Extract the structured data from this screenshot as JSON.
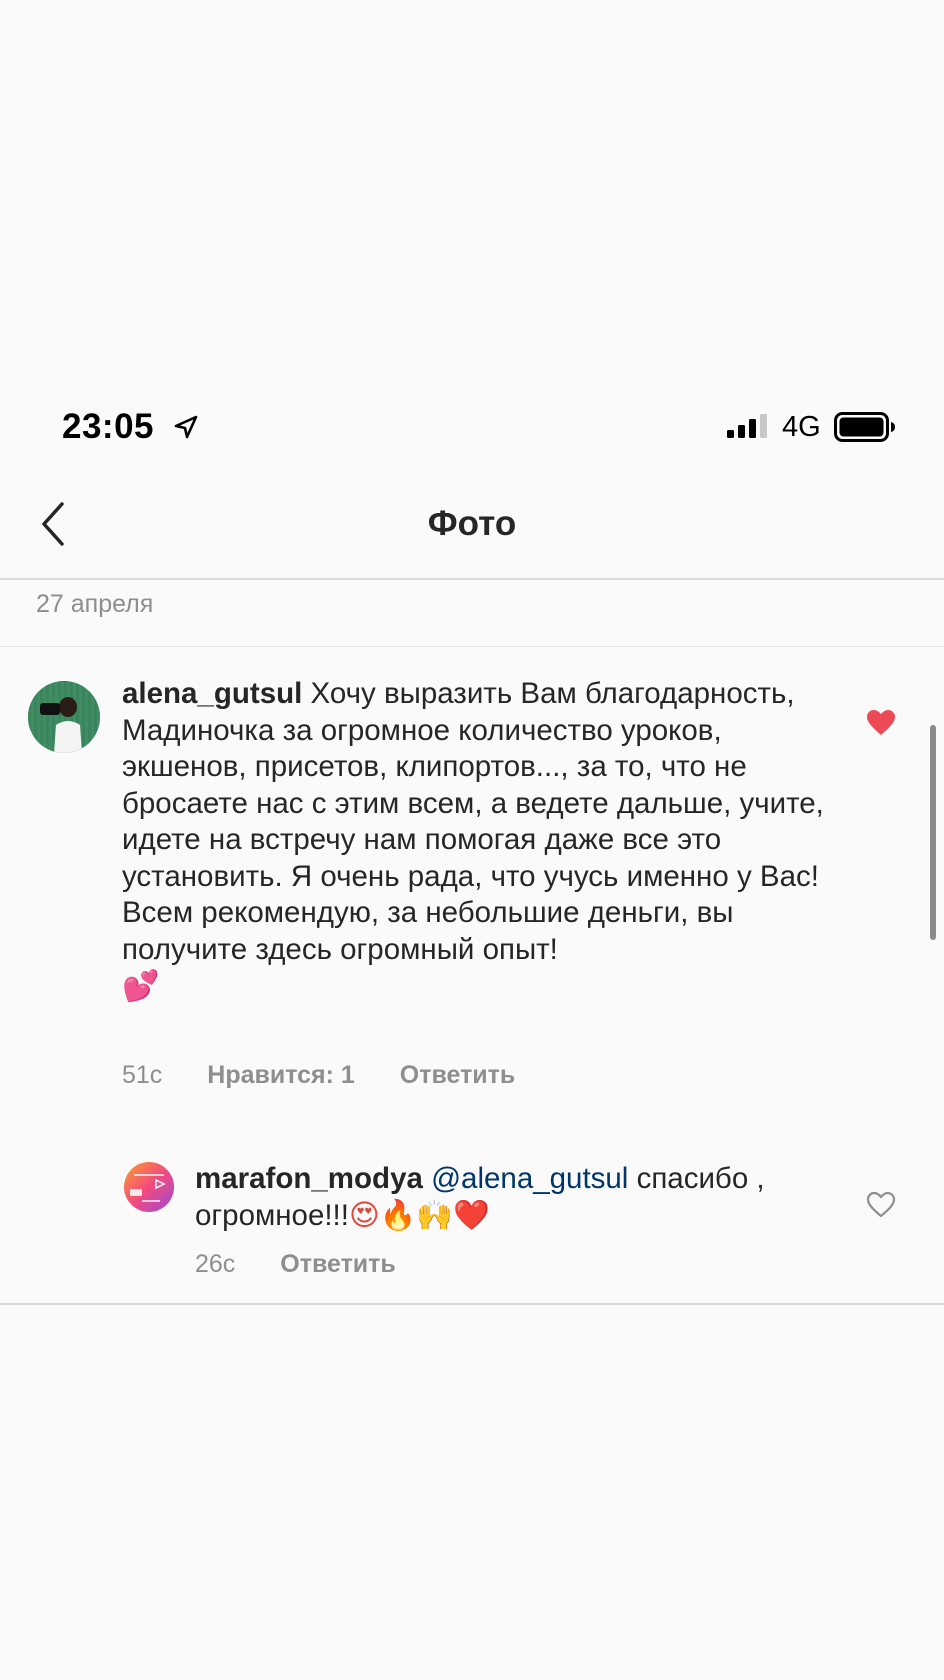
{
  "status_bar": {
    "time": "23:05",
    "network": "4G"
  },
  "header": {
    "title": "Фото"
  },
  "post": {
    "date": "27 апреля"
  },
  "comments": [
    {
      "username": "alena_gutsul",
      "text": "Хочу выразить Вам благодарность,  Мадиночка за огромное количество уроков,  экшенов, присетов, клипортов..., за то, что не бросаете нас с этим всем,  а ведете дальше,  учите,  идете на встречу нам помогая даже все это установить. Я очень рада,  что учусь именно у Вас!  Всем рекомендую,  за небольшие деньги,  вы получите здесь огромный опыт!",
      "emoji": "💕",
      "time": "51с",
      "likes_label": "Нравится: 1",
      "reply_label": "Ответить",
      "liked": true
    },
    {
      "username": "marafon_modya",
      "mention": "@alena_gutsul",
      "text": "спасибо , огромное!!!",
      "emoji": "😍🔥🙌❤️",
      "time": "26с",
      "reply_label": "Ответить",
      "liked": false
    }
  ],
  "colors": {
    "background": "#fafafa",
    "liked_heart": "#ed4956",
    "mention": "#003569",
    "secondary_text": "#8e8e8e",
    "divider": "#dbdbdb"
  },
  "icons": [
    "location-arrow-icon",
    "signal-icon",
    "battery-icon",
    "chevron-left-icon",
    "heart-filled-icon",
    "heart-outline-icon"
  ]
}
